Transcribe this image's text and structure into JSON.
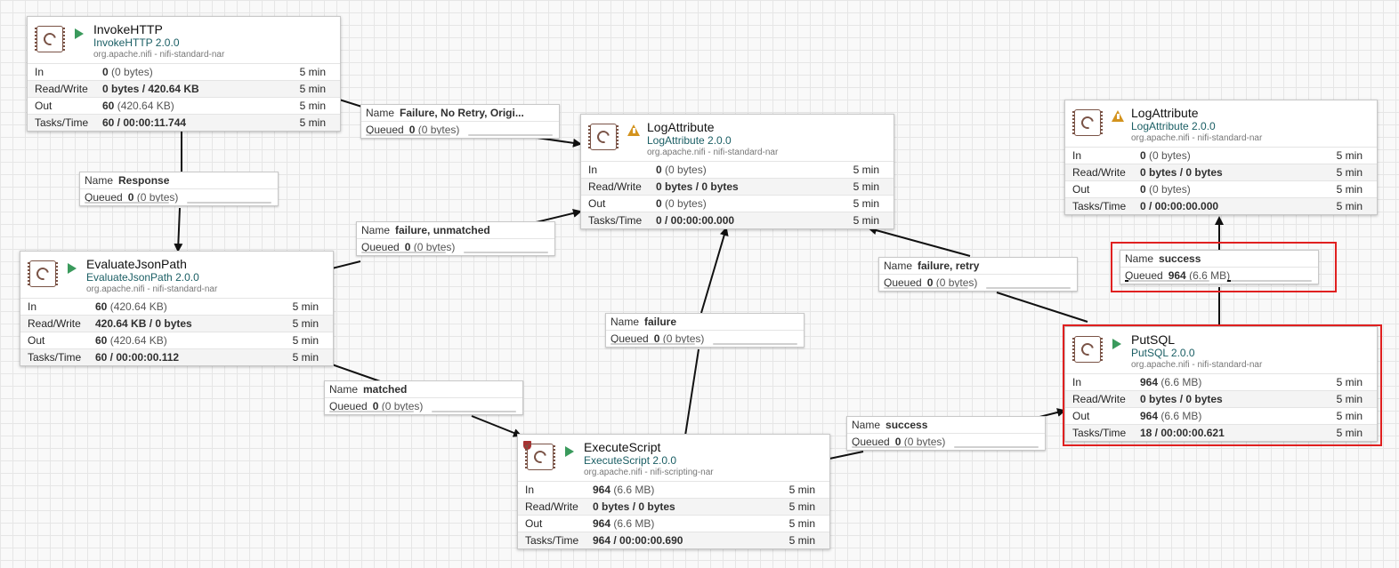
{
  "processors": {
    "invokehttp": {
      "name": "InvokeHTTP",
      "type": "InvokeHTTP 2.0.0",
      "bundle": "org.apache.nifi - nifi-standard-nar",
      "state_icon": "running-icon",
      "in": {
        "label": "In",
        "value": "0",
        "detail": "(0 bytes)",
        "time": "5 min"
      },
      "rw": {
        "label": "Read/Write",
        "value": "0 bytes / 420.64 KB",
        "time": "5 min"
      },
      "out": {
        "label": "Out",
        "value": "60",
        "detail": "(420.64 KB)",
        "time": "5 min"
      },
      "tasks": {
        "label": "Tasks/Time",
        "value": "60 / 00:00:11.744",
        "time": "5 min"
      }
    },
    "evaluatejsonpath": {
      "name": "EvaluateJsonPath",
      "type": "EvaluateJsonPath 2.0.0",
      "bundle": "org.apache.nifi - nifi-standard-nar",
      "state_icon": "running-icon",
      "in": {
        "label": "In",
        "value": "60",
        "detail": "(420.64 KB)",
        "time": "5 min"
      },
      "rw": {
        "label": "Read/Write",
        "value": "420.64 KB / 0 bytes",
        "time": "5 min"
      },
      "out": {
        "label": "Out",
        "value": "60",
        "detail": "(420.64 KB)",
        "time": "5 min"
      },
      "tasks": {
        "label": "Tasks/Time",
        "value": "60 / 00:00:00.112",
        "time": "5 min"
      }
    },
    "logattribute1": {
      "name": "LogAttribute",
      "type": "LogAttribute 2.0.0",
      "bundle": "org.apache.nifi - nifi-standard-nar",
      "state_icon": "warning-icon",
      "in": {
        "label": "In",
        "value": "0",
        "detail": "(0 bytes)",
        "time": "5 min"
      },
      "rw": {
        "label": "Read/Write",
        "value": "0 bytes / 0 bytes",
        "time": "5 min"
      },
      "out": {
        "label": "Out",
        "value": "0",
        "detail": "(0 bytes)",
        "time": "5 min"
      },
      "tasks": {
        "label": "Tasks/Time",
        "value": "0 / 00:00:00.000",
        "time": "5 min"
      }
    },
    "logattribute2": {
      "name": "LogAttribute",
      "type": "LogAttribute 2.0.0",
      "bundle": "org.apache.nifi - nifi-standard-nar",
      "state_icon": "warning-icon",
      "in": {
        "label": "In",
        "value": "0",
        "detail": "(0 bytes)",
        "time": "5 min"
      },
      "rw": {
        "label": "Read/Write",
        "value": "0 bytes / 0 bytes",
        "time": "5 min"
      },
      "out": {
        "label": "Out",
        "value": "0",
        "detail": "(0 bytes)",
        "time": "5 min"
      },
      "tasks": {
        "label": "Tasks/Time",
        "value": "0 / 00:00:00.000",
        "time": "5 min"
      }
    },
    "executescript": {
      "name": "ExecuteScript",
      "type": "ExecuteScript 2.0.0",
      "bundle": "org.apache.nifi - nifi-scripting-nar",
      "state_icon": "running-icon",
      "in": {
        "label": "In",
        "value": "964",
        "detail": "(6.6 MB)",
        "time": "5 min"
      },
      "rw": {
        "label": "Read/Write",
        "value": "0 bytes / 0 bytes",
        "time": "5 min"
      },
      "out": {
        "label": "Out",
        "value": "964",
        "detail": "(6.6 MB)",
        "time": "5 min"
      },
      "tasks": {
        "label": "Tasks/Time",
        "value": "964 / 00:00:00.690",
        "time": "5 min"
      }
    },
    "putsql": {
      "name": "PutSQL",
      "type": "PutSQL 2.0.0",
      "bundle": "org.apache.nifi - nifi-standard-nar",
      "state_icon": "running-icon",
      "in": {
        "label": "In",
        "value": "964",
        "detail": "(6.6 MB)",
        "time": "5 min"
      },
      "rw": {
        "label": "Read/Write",
        "value": "0 bytes / 0 bytes",
        "time": "5 min"
      },
      "out": {
        "label": "Out",
        "value": "964",
        "detail": "(6.6 MB)",
        "time": "5 min"
      },
      "tasks": {
        "label": "Tasks/Time",
        "value": "18 / 00:00:00.621",
        "time": "5 min"
      }
    }
  },
  "connections": {
    "failure_noretry": {
      "name_key": "Name",
      "name": "Failure, No Retry, Origi...",
      "queued_key": "Queued",
      "count": "0",
      "size": "(0 bytes)",
      "fill": 0
    },
    "response": {
      "name_key": "Name",
      "name": "Response",
      "queued_key": "Queued",
      "count": "0",
      "size": "(0 bytes)",
      "fill": 0
    },
    "failure_unmatched": {
      "name_key": "Name",
      "name": "failure, unmatched",
      "queued_key": "Queued",
      "count": "0",
      "size": "(0 bytes)",
      "fill": 0
    },
    "matched": {
      "name_key": "Name",
      "name": "matched",
      "queued_key": "Queued",
      "count": "0",
      "size": "(0 bytes)",
      "fill": 0
    },
    "failure": {
      "name_key": "Name",
      "name": "failure",
      "queued_key": "Queued",
      "count": "0",
      "size": "(0 bytes)",
      "fill": 0
    },
    "success_exec": {
      "name_key": "Name",
      "name": "success",
      "queued_key": "Queued",
      "count": "0",
      "size": "(0 bytes)",
      "fill": 0
    },
    "failure_retry": {
      "name_key": "Name",
      "name": "failure, retry",
      "queued_key": "Queued",
      "count": "0",
      "size": "(0 bytes)",
      "fill": 0
    },
    "success_put": {
      "name_key": "Name",
      "name": "success",
      "queued_key": "Queued",
      "count": "964",
      "size": "(6.6 MB)",
      "fill": 0.04
    }
  }
}
